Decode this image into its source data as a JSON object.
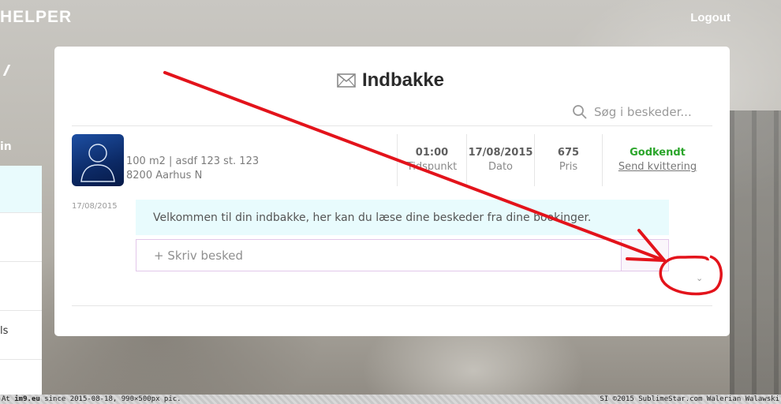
{
  "header": {
    "brand": "HELPER",
    "logout_label": "Logout"
  },
  "sidebar": {
    "fragment_label": "in",
    "items": [
      "",
      "",
      "",
      "",
      "ls",
      ""
    ]
  },
  "inbox": {
    "title": "Indbakke",
    "search_placeholder": "Søg i beskeder...",
    "booking": {
      "address_line1": "100 m2 | asdf 123 st. 123",
      "address_line2": "8200 Aarhus N",
      "time_value": "01:00",
      "time_label": "Tidspunkt",
      "date_value": "17/08/2015",
      "date_label": "Dato",
      "price_value": "675",
      "price_label": "Pris",
      "status": "Godkendt",
      "receipt_link": "Send kvittering"
    },
    "message": {
      "date": "17/08/2015",
      "text": "Velkommen til din indbakke, her kan du læse dine beskeder fra dine bookinger."
    },
    "compose_placeholder": "+ Skriv besked"
  },
  "footer": {
    "left_prefix": "At ",
    "left_site": "im9.eu",
    "left_rest": " since 2015-08-18, 990×500px pic.",
    "right": "SI ©2015 SublimeStar.com Walerian Walawski"
  },
  "colors": {
    "status_green": "#2aa52a",
    "annotation_red": "#e3131b",
    "bubble_bg": "#e8fbfd"
  }
}
